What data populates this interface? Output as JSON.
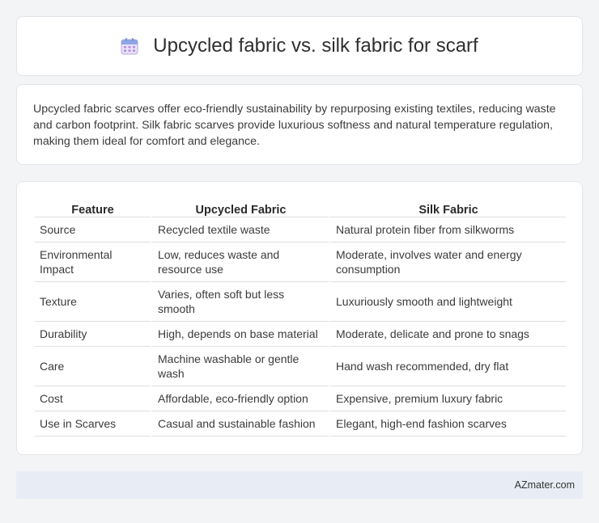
{
  "header": {
    "title": "Upcycled fabric vs. silk fabric for scarf",
    "icon": "calendar-icon"
  },
  "summary": {
    "text": "Upcycled fabric scarves offer eco-friendly sustainability by repurposing existing textiles, reducing waste and carbon footprint. Silk fabric scarves provide luxurious softness and natural temperature regulation, making them ideal for comfort and elegance."
  },
  "table": {
    "headers": [
      "Feature",
      "Upcycled Fabric",
      "Silk Fabric"
    ],
    "rows": [
      [
        "Source",
        "Recycled textile waste",
        "Natural protein fiber from silkworms"
      ],
      [
        "Environmental Impact",
        "Low, reduces waste and resource use",
        "Moderate, involves water and energy consumption"
      ],
      [
        "Texture",
        "Varies, often soft but less smooth",
        "Luxuriously smooth and lightweight"
      ],
      [
        "Durability",
        "High, depends on base material",
        "Moderate, delicate and prone to snags"
      ],
      [
        "Care",
        "Machine washable or gentle wash",
        "Hand wash recommended, dry flat"
      ],
      [
        "Cost",
        "Affordable, eco-friendly option",
        "Expensive, premium luxury fabric"
      ],
      [
        "Use in Scarves",
        "Casual and sustainable fashion",
        "Elegant, high-end fashion scarves"
      ]
    ]
  },
  "footer": {
    "brand": "AZmater.com"
  },
  "colors": {
    "background": "#f3f4f6",
    "card": "#ffffff",
    "footer": "#e8edf5",
    "icon_accent": "#9b7fd4"
  }
}
